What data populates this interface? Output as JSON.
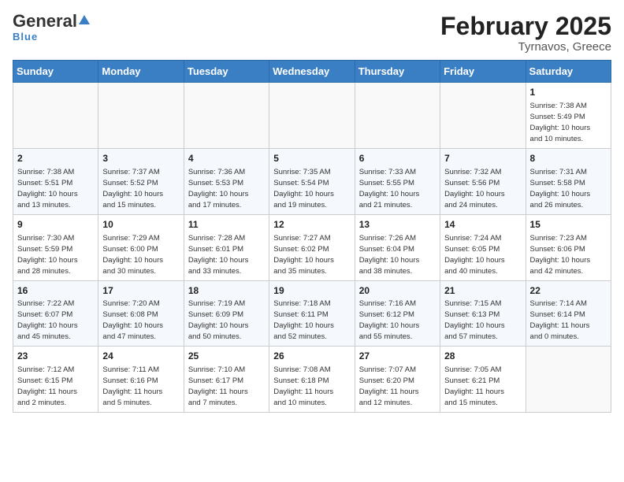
{
  "header": {
    "logo_general": "General",
    "logo_blue": "Blue",
    "title": "February 2025",
    "subtitle": "Tyrnavos, Greece"
  },
  "calendar": {
    "days_of_week": [
      "Sunday",
      "Monday",
      "Tuesday",
      "Wednesday",
      "Thursday",
      "Friday",
      "Saturday"
    ],
    "weeks": [
      [
        {
          "day": "",
          "info": ""
        },
        {
          "day": "",
          "info": ""
        },
        {
          "day": "",
          "info": ""
        },
        {
          "day": "",
          "info": ""
        },
        {
          "day": "",
          "info": ""
        },
        {
          "day": "",
          "info": ""
        },
        {
          "day": "1",
          "info": "Sunrise: 7:38 AM\nSunset: 5:49 PM\nDaylight: 10 hours\nand 10 minutes."
        }
      ],
      [
        {
          "day": "2",
          "info": "Sunrise: 7:38 AM\nSunset: 5:51 PM\nDaylight: 10 hours\nand 13 minutes."
        },
        {
          "day": "3",
          "info": "Sunrise: 7:37 AM\nSunset: 5:52 PM\nDaylight: 10 hours\nand 15 minutes."
        },
        {
          "day": "4",
          "info": "Sunrise: 7:36 AM\nSunset: 5:53 PM\nDaylight: 10 hours\nand 17 minutes."
        },
        {
          "day": "5",
          "info": "Sunrise: 7:35 AM\nSunset: 5:54 PM\nDaylight: 10 hours\nand 19 minutes."
        },
        {
          "day": "6",
          "info": "Sunrise: 7:33 AM\nSunset: 5:55 PM\nDaylight: 10 hours\nand 21 minutes."
        },
        {
          "day": "7",
          "info": "Sunrise: 7:32 AM\nSunset: 5:56 PM\nDaylight: 10 hours\nand 24 minutes."
        },
        {
          "day": "8",
          "info": "Sunrise: 7:31 AM\nSunset: 5:58 PM\nDaylight: 10 hours\nand 26 minutes."
        }
      ],
      [
        {
          "day": "9",
          "info": "Sunrise: 7:30 AM\nSunset: 5:59 PM\nDaylight: 10 hours\nand 28 minutes."
        },
        {
          "day": "10",
          "info": "Sunrise: 7:29 AM\nSunset: 6:00 PM\nDaylight: 10 hours\nand 30 minutes."
        },
        {
          "day": "11",
          "info": "Sunrise: 7:28 AM\nSunset: 6:01 PM\nDaylight: 10 hours\nand 33 minutes."
        },
        {
          "day": "12",
          "info": "Sunrise: 7:27 AM\nSunset: 6:02 PM\nDaylight: 10 hours\nand 35 minutes."
        },
        {
          "day": "13",
          "info": "Sunrise: 7:26 AM\nSunset: 6:04 PM\nDaylight: 10 hours\nand 38 minutes."
        },
        {
          "day": "14",
          "info": "Sunrise: 7:24 AM\nSunset: 6:05 PM\nDaylight: 10 hours\nand 40 minutes."
        },
        {
          "day": "15",
          "info": "Sunrise: 7:23 AM\nSunset: 6:06 PM\nDaylight: 10 hours\nand 42 minutes."
        }
      ],
      [
        {
          "day": "16",
          "info": "Sunrise: 7:22 AM\nSunset: 6:07 PM\nDaylight: 10 hours\nand 45 minutes."
        },
        {
          "day": "17",
          "info": "Sunrise: 7:20 AM\nSunset: 6:08 PM\nDaylight: 10 hours\nand 47 minutes."
        },
        {
          "day": "18",
          "info": "Sunrise: 7:19 AM\nSunset: 6:09 PM\nDaylight: 10 hours\nand 50 minutes."
        },
        {
          "day": "19",
          "info": "Sunrise: 7:18 AM\nSunset: 6:11 PM\nDaylight: 10 hours\nand 52 minutes."
        },
        {
          "day": "20",
          "info": "Sunrise: 7:16 AM\nSunset: 6:12 PM\nDaylight: 10 hours\nand 55 minutes."
        },
        {
          "day": "21",
          "info": "Sunrise: 7:15 AM\nSunset: 6:13 PM\nDaylight: 10 hours\nand 57 minutes."
        },
        {
          "day": "22",
          "info": "Sunrise: 7:14 AM\nSunset: 6:14 PM\nDaylight: 11 hours\nand 0 minutes."
        }
      ],
      [
        {
          "day": "23",
          "info": "Sunrise: 7:12 AM\nSunset: 6:15 PM\nDaylight: 11 hours\nand 2 minutes."
        },
        {
          "day": "24",
          "info": "Sunrise: 7:11 AM\nSunset: 6:16 PM\nDaylight: 11 hours\nand 5 minutes."
        },
        {
          "day": "25",
          "info": "Sunrise: 7:10 AM\nSunset: 6:17 PM\nDaylight: 11 hours\nand 7 minutes."
        },
        {
          "day": "26",
          "info": "Sunrise: 7:08 AM\nSunset: 6:18 PM\nDaylight: 11 hours\nand 10 minutes."
        },
        {
          "day": "27",
          "info": "Sunrise: 7:07 AM\nSunset: 6:20 PM\nDaylight: 11 hours\nand 12 minutes."
        },
        {
          "day": "28",
          "info": "Sunrise: 7:05 AM\nSunset: 6:21 PM\nDaylight: 11 hours\nand 15 minutes."
        },
        {
          "day": "",
          "info": ""
        }
      ]
    ]
  }
}
